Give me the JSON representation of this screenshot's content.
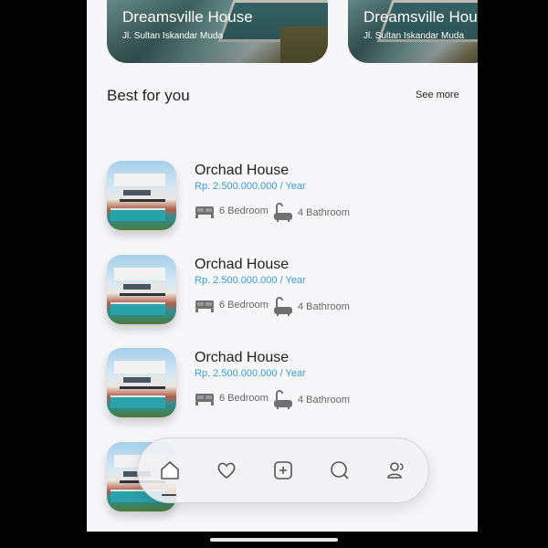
{
  "featured": [
    {
      "name": "Dreamsville House",
      "address": "Jl. Sultan Iskandar Muda"
    },
    {
      "name": "Dreamsville House",
      "address": "Jl. Sultan Iskandar Muda"
    }
  ],
  "section": {
    "title": "Best for you",
    "see_more": "See more"
  },
  "listings": [
    {
      "name": "Orchad House",
      "price": "Rp. 2.500.000.000 / Year",
      "bedrooms": "6 Bedroom",
      "bathrooms": "4 Bathroom"
    },
    {
      "name": "Orchad House",
      "price": "Rp. 2.500.000.000 / Year",
      "bedrooms": "6 Bedroom",
      "bathrooms": "4 Bathroom"
    },
    {
      "name": "Orchad House",
      "price": "Rp. 2.500.000.000 / Year",
      "bedrooms": "6 Bedroom",
      "bathrooms": "4 Bathroom"
    }
  ],
  "nav": {
    "items": [
      "home-icon",
      "heart-icon",
      "add-icon",
      "search-icon",
      "profile-icon"
    ],
    "active": "home-icon"
  },
  "colors": {
    "accent": "#3c9ad6",
    "background": "#f7f7f9",
    "text": "#222222"
  }
}
